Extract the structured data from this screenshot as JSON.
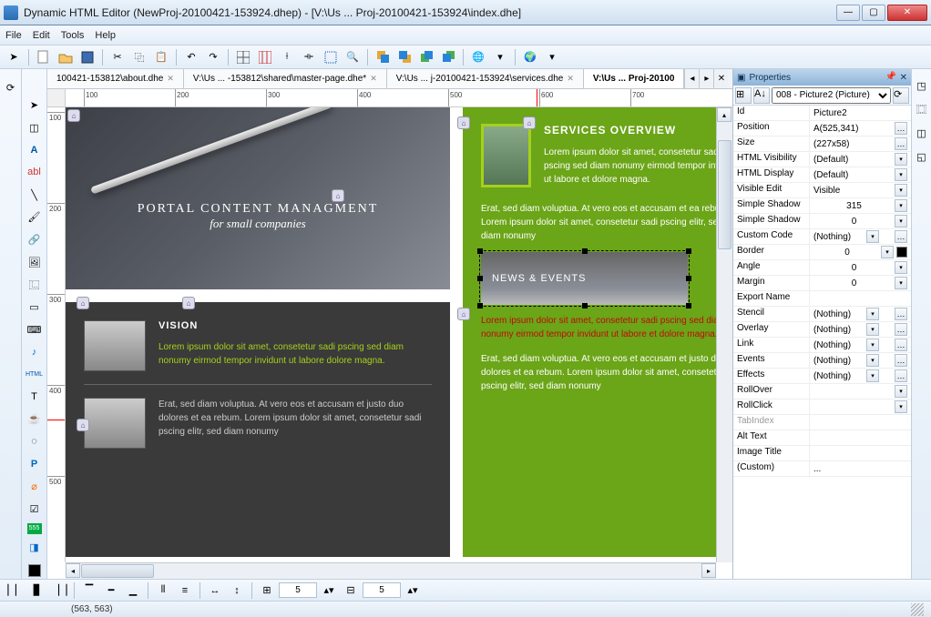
{
  "window": {
    "title": "Dynamic HTML Editor (NewProj-20100421-153924.dhep) - [V:\\Us ... Proj-20100421-153924\\index.dhe]"
  },
  "menu": {
    "file": "File",
    "edit": "Edit",
    "tools": "Tools",
    "help": "Help"
  },
  "doc_tabs": {
    "t1": "100421-153812\\about.dhe",
    "t2": "V:\\Us ... -153812\\shared\\master-page.dhe*",
    "t3": "V:\\Us ... j-20100421-153924\\services.dhe",
    "t4": "V:\\Us ... Proj-20100"
  },
  "design": {
    "hero_title": "PORTAL CONTENT MANAGMENT",
    "hero_sub": "for small companies",
    "vision": "VISION",
    "vision_p1": "Lorem ipsum dolor sit amet, consetetur sadi pscing sed diam nonumy eirmod tempor invidunt ut labore dolore magna.",
    "vision_p2": "Erat, sed diam voluptua. At vero eos et accusam et justo duo dolores et ea rebum. Lorem ipsum dolor sit amet, consetetur sadi pscing elitr, sed diam nonumy",
    "svc": "SERVICES OVERVIEW",
    "svc_p1": "Lorem ipsum dolor sit amet, consetetur sadi pscing sed diam nonumy eirmod tempor invidunt ut labore et dolore magna.",
    "svc_p2": "Erat, sed diam voluptua. At vero eos et accusam et ea rebum. Lorem ipsum dolor sit amet, consetetur sadi pscing elitr, sed diam nonumy",
    "news": "NEWS & EVENTS",
    "news_p1": "Lorem ipsum dolor sit amet, consetetur sadi pscing sed diam nonumy eirmod tempor invidunt ut labore et dolore magna.",
    "news_p2": "Erat, sed diam voluptua. At vero eos et accusam et justo duo dolores et ea rebum. Lorem ipsum dolor sit amet, consetetur sadi pscing elitr, sed diam nonumy"
  },
  "props": {
    "panel_title": "Properties",
    "selected": "008 - Picture2 (Picture)",
    "rows": [
      [
        "Id",
        "Picture2",
        "",
        ""
      ],
      [
        "Position",
        "A(525,341)",
        "",
        "..."
      ],
      [
        "Size",
        "(227x58)",
        "",
        "..."
      ],
      [
        "HTML Visibility",
        "(Default)",
        "dd",
        ""
      ],
      [
        "HTML Display",
        "(Default)",
        "dd",
        ""
      ],
      [
        "Visible Edit",
        "Visible",
        "dd",
        ""
      ],
      [
        "Simple Shadow",
        "315",
        "spin",
        ""
      ],
      [
        "Simple Shadow",
        "0",
        "spin",
        ""
      ],
      [
        "Custom Code",
        "(Nothing)",
        "dd",
        "..."
      ],
      [
        "Border",
        "0",
        "spin",
        "sw"
      ],
      [
        "Angle",
        "0",
        "spin",
        ""
      ],
      [
        "Margin",
        "0",
        "spin",
        ""
      ],
      [
        "Export Name",
        "",
        "",
        ""
      ],
      [
        "Stencil",
        "(Nothing)",
        "dd",
        "..."
      ],
      [
        "Overlay",
        "(Nothing)",
        "dd",
        "..."
      ],
      [
        "Link",
        "(Nothing)",
        "dd",
        "..."
      ],
      [
        "Events",
        "(Nothing)",
        "dd",
        "..."
      ],
      [
        "Effects",
        "(Nothing)",
        "dd",
        "..."
      ],
      [
        "RollOver",
        "",
        "dd",
        ""
      ],
      [
        "RollClick",
        "",
        "dd",
        ""
      ],
      [
        "TabIndex",
        "",
        "",
        "",
        "disabled"
      ],
      [
        "Alt Text",
        "",
        "",
        ""
      ],
      [
        "Image Title",
        "",
        "",
        ""
      ],
      [
        "(Custom)",
        "...",
        "",
        ""
      ]
    ]
  },
  "status": {
    "coords": "(563, 563)"
  },
  "bottom": {
    "n1": "5",
    "n2": "5"
  }
}
